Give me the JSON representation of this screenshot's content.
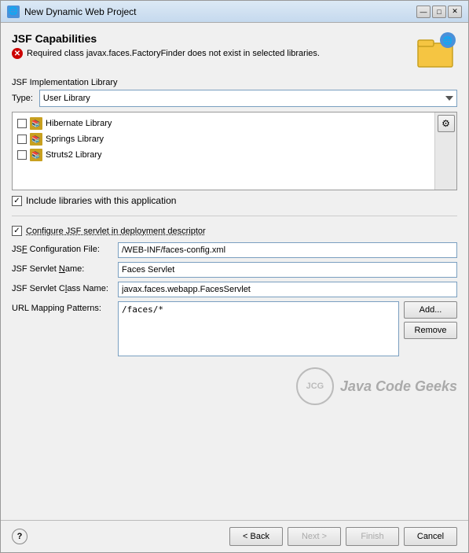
{
  "window": {
    "title": "New Dynamic Web Project",
    "title_icon": "🌐"
  },
  "page": {
    "title": "JSF Capabilities",
    "error": "Required class javax.faces.FactoryFinder does not exist in selected libraries."
  },
  "jsf_implementation": {
    "section_label": "JSF Implementation Library",
    "type_label": "Type:",
    "type_value": "User Library",
    "libraries": [
      {
        "name": "Hibernate Library",
        "checked": false
      },
      {
        "name": "Springs Library",
        "checked": false
      },
      {
        "name": "Struts2 Library",
        "checked": false
      }
    ],
    "include_label": "Include libraries with this application",
    "include_checked": true
  },
  "configure": {
    "label": "Configure JSF servlet in deployment descriptor",
    "checked": true,
    "fields": {
      "config_file_label": "JSF Configuration File:",
      "config_file_value": "/WEB-INF/faces-config.xml",
      "servlet_name_label": "JSF Servlet Name:",
      "servlet_name_value": "Faces Servlet",
      "servlet_class_label": "JSF Servlet Class Name:",
      "servlet_class_value": "javax.faces.webapp.FacesServlet",
      "url_mapping_label": "URL Mapping Patterns:",
      "url_mapping_value": "/faces/*"
    },
    "buttons": {
      "add": "Add...",
      "remove": "Remove"
    }
  },
  "watermark": {
    "logo_text": "JCG",
    "brand_text": "Java Code Geeks"
  },
  "bottom": {
    "back": "< Back",
    "next": "Next >",
    "finish": "Finish",
    "cancel": "Cancel"
  }
}
